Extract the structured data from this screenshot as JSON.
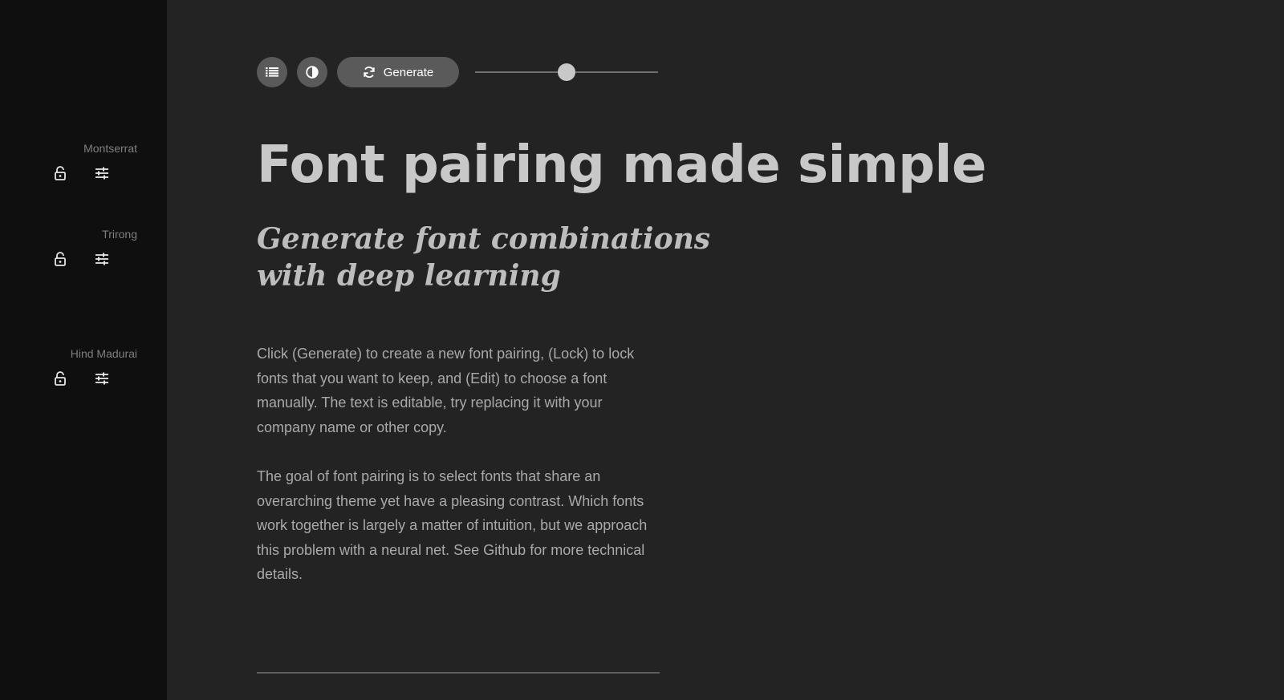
{
  "sidebar": {
    "fonts": [
      {
        "name": "Montserrat",
        "lock_icon": "lock-open-icon",
        "edit_icon": "sliders-icon"
      },
      {
        "name": "Trirong",
        "lock_icon": "lock-open-icon",
        "edit_icon": "sliders-icon"
      },
      {
        "name": "Hind Madurai",
        "lock_icon": "lock-open-icon",
        "edit_icon": "sliders-icon"
      }
    ]
  },
  "toolbar": {
    "list_icon": "list-icon",
    "contrast_icon": "contrast-icon",
    "generate_label": "Generate",
    "generate_icon": "refresh-icon",
    "slider_value": 0.5
  },
  "content": {
    "headline": "Font pairing made simple",
    "subheadline": "Generate font combinations with deep learning",
    "paragraphs": [
      "Click (Generate) to create a new font pairing, (Lock) to lock fonts that you want to keep, and (Edit) to choose a font manually. The text is editable, try replacing it with your company name or other copy.",
      "The goal of font pairing is to select fonts that share an overarching theme yet have a pleasing contrast. Which fonts work together is largely a matter of intuition, but we approach this problem with a neural net. See Github for more technical details."
    ]
  },
  "colors": {
    "sidebar_bg": "#0f0f0f",
    "main_bg": "#232323",
    "button_bg": "#5a5a5a",
    "headline": "#c8c8c8",
    "body": "#a9a9a9"
  }
}
